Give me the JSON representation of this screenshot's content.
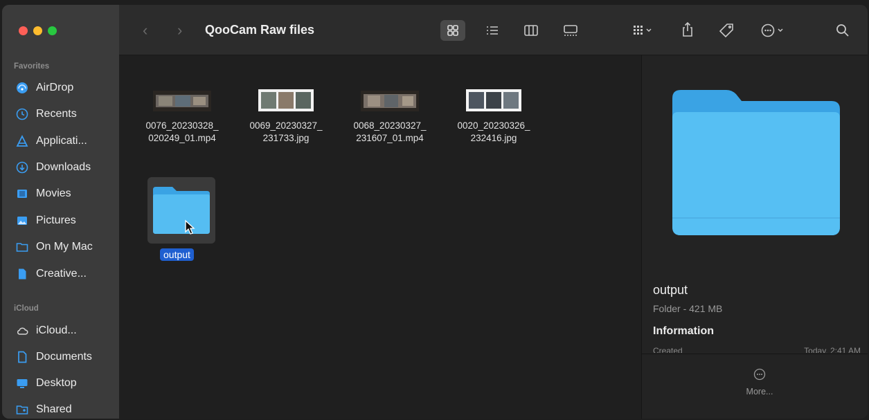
{
  "window": {
    "title": "QooCam Raw files"
  },
  "sidebar": {
    "favorites_title": "Favorites",
    "favorites": [
      {
        "label": "AirDrop",
        "icon": "airdrop-icon"
      },
      {
        "label": "Recents",
        "icon": "clock-icon"
      },
      {
        "label": "Applicati...",
        "icon": "applications-icon"
      },
      {
        "label": "Downloads",
        "icon": "download-icon"
      },
      {
        "label": "Movies",
        "icon": "film-icon"
      },
      {
        "label": "Pictures",
        "icon": "photo-icon"
      },
      {
        "label": "On My Mac",
        "icon": "folder-icon"
      },
      {
        "label": "Creative...",
        "icon": "document-icon"
      }
    ],
    "icloud_title": "iCloud",
    "icloud": [
      {
        "label": "iCloud...",
        "icon": "cloud-icon"
      },
      {
        "label": "Documents",
        "icon": "document-icon"
      },
      {
        "label": "Desktop",
        "icon": "desktop-icon"
      },
      {
        "label": "Shared",
        "icon": "shared-folder-icon"
      }
    ]
  },
  "files": [
    {
      "line1": "0076_20230328_",
      "line2": "020249_01.mp4"
    },
    {
      "line1": "0069_20230327_",
      "line2": "231733.jpg"
    },
    {
      "line1": "0068_20230327_",
      "line2": "231607_01.mp4"
    },
    {
      "line1": "0020_20230326_",
      "line2": "232416.jpg"
    }
  ],
  "folder": {
    "label": "output"
  },
  "preview": {
    "name": "output",
    "subtitle": "Folder - 421 MB",
    "information": "Information",
    "created_label": "Created",
    "created_value": "Today, 2:41 AM",
    "more": "More..."
  },
  "colors": {
    "accent": "#3a9df2",
    "selection": "#1f5fd0",
    "folder": "#4db3f0"
  }
}
